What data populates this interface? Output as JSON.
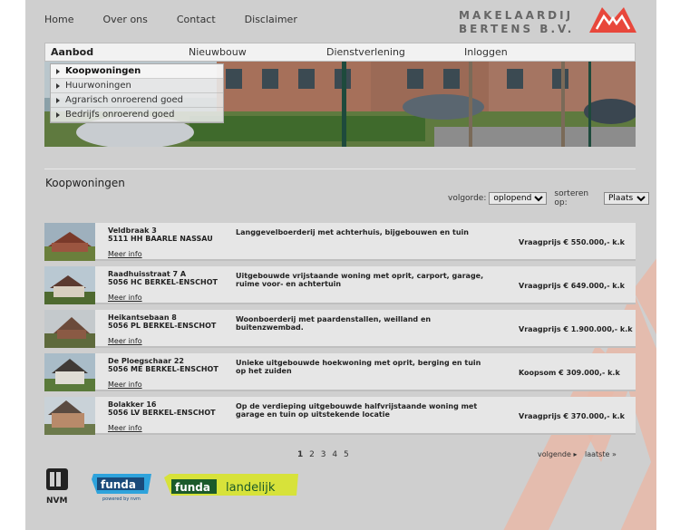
{
  "topnav": {
    "items": [
      "Home",
      "Over ons",
      "Contact",
      "Disclaimer"
    ]
  },
  "logo": {
    "line1": "MAKELAARDIJ",
    "line2": "BERTENS B.V."
  },
  "mainnav": {
    "items": [
      "Aanbod",
      "Nieuwbouw",
      "Dienstverlening",
      "Inloggen"
    ]
  },
  "submenu": {
    "items": [
      "Koopwoningen",
      "Huurwoningen",
      "Agrarisch onroerend goed",
      "Bedrijfs onroerend goed"
    ]
  },
  "page_title": "Koopwoningen",
  "sorting": {
    "volgorde_label": "volgorde:",
    "volgorde_value": "oplopend",
    "sorteren_label": "sorteren op:",
    "sorteren_value": "Plaats"
  },
  "listings": [
    {
      "street": "Veldbraak 3",
      "city": "5111 HH BAARLE NASSAU",
      "description": "Langgevelboerderij met achterhuis, bijgebouwen en tuin",
      "price": "Vraagprijs € 550.000,- k.k",
      "more": "Meer info"
    },
    {
      "street": "Raadhuisstraat 7 A",
      "city": "5056 HC BERKEL-ENSCHOT",
      "description": "Uitgebouwde vrijstaande woning met oprit, carport, garage, ruime voor- en achtertuin",
      "price": "Vraagprijs € 649.000,- k.k",
      "more": "Meer info"
    },
    {
      "street": "Heikantsebaan 8",
      "city": "5056 PL BERKEL-ENSCHOT",
      "description": "Woonboerderij met paardenstallen, weilland en buitenzwembad.",
      "price": "Vraagprijs € 1.900.000,- k.k",
      "more": "Meer info"
    },
    {
      "street": "De Ploegschaar 22",
      "city": "5056 ME BERKEL-ENSCHOT",
      "description": "Unieke uitgebouwde hoekwoning met oprit, berging en tuin op het zuiden",
      "price": "Koopsom € 309.000,- k.k",
      "more": "Meer info"
    },
    {
      "street": "Bolakker 16",
      "city": "5056 LV BERKEL-ENSCHOT",
      "description": "Op de verdieping uitgebouwde halfvrijstaande woning met garage en tuin op uitstekende locatie",
      "price": "Vraagprijs € 370.000,- k.k",
      "more": "Meer info"
    }
  ],
  "pager": {
    "pages": [
      "1",
      "2",
      "3",
      "4",
      "5"
    ],
    "current": "1",
    "next": "volgende",
    "last": "laatste"
  },
  "footer": {
    "nvm": "NVM",
    "funda": "funda",
    "funda_sub": "powered by nvm",
    "funda2": "funda",
    "landelijk": "landelijk"
  },
  "colors": {
    "accent": "#e8473b",
    "background": "#cfcfcf",
    "row": "#e6e6e6"
  }
}
